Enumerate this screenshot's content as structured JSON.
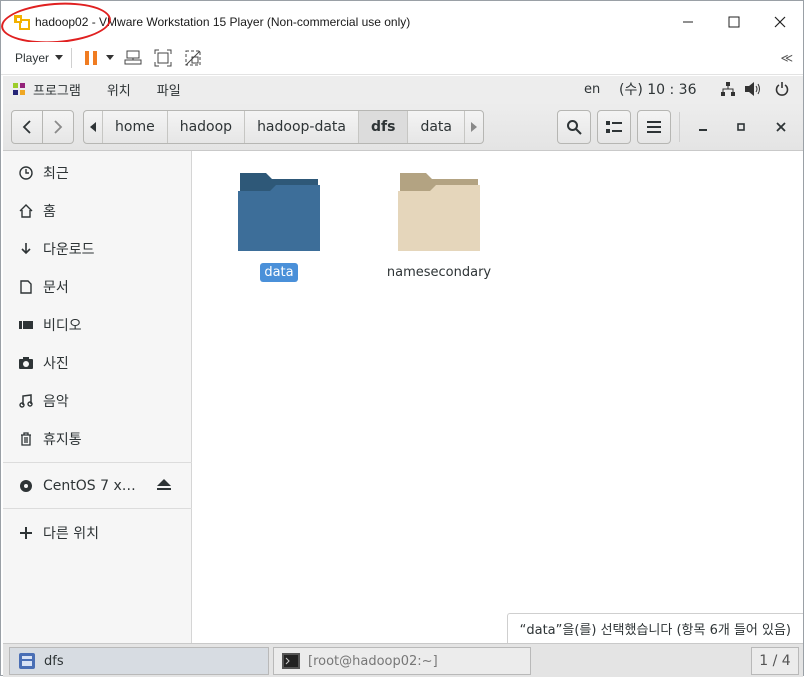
{
  "window": {
    "title": "hadoop02 - VMware Workstation 15 Player (Non-commercial use only)"
  },
  "vmtoolbar": {
    "player_label": "Player",
    "collapse_glyph": "≪"
  },
  "gnome_bar": {
    "menu": [
      "프로그램",
      "위치",
      "파일"
    ],
    "lang": "en",
    "clock": "(수) 10 : 36"
  },
  "pathbar": {
    "crumbs": [
      "home",
      "hadoop",
      "hadoop-data",
      "dfs",
      "data"
    ],
    "active_index": 3
  },
  "sidebar": {
    "items": [
      {
        "label": "최근",
        "icon": "clock-icon"
      },
      {
        "label": "홈",
        "icon": "home-icon"
      },
      {
        "label": "다운로드",
        "icon": "download-icon"
      },
      {
        "label": "문서",
        "icon": "document-icon"
      },
      {
        "label": "비디오",
        "icon": "video-icon"
      },
      {
        "label": "사진",
        "icon": "camera-icon"
      },
      {
        "label": "음악",
        "icon": "music-icon"
      },
      {
        "label": "휴지통",
        "icon": "trash-icon"
      }
    ],
    "device": {
      "label": "CentOS 7 x…",
      "icon": "disc-icon"
    },
    "other": {
      "label": "다른 위치",
      "icon": "plus-icon"
    }
  },
  "files": [
    {
      "name": "data",
      "selected": true,
      "color": "#3d6e99"
    },
    {
      "name": "namesecondary",
      "selected": false,
      "color": "#dcc9a8"
    }
  ],
  "status": {
    "text": "“data”을(를) 선택했습니다 (항목 6개 들어 있음)"
  },
  "taskbar": {
    "task1": "dfs",
    "task2": "[root@hadoop02:~]",
    "pages": "1 / 4"
  },
  "colors": {
    "selection": "#4a90d9",
    "annotation": "#e02020",
    "pause": "#f07c21"
  }
}
